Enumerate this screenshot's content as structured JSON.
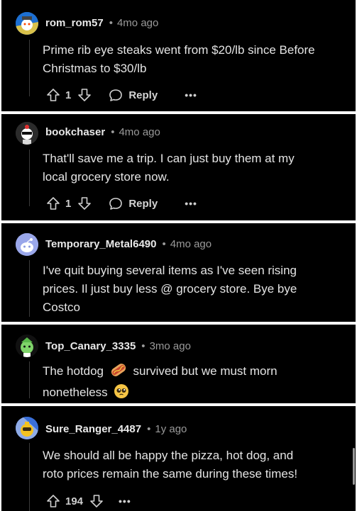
{
  "comments": [
    {
      "username": "rom_rom57",
      "separator": "•",
      "time": "4mo ago",
      "body_lines": [
        "Prime rib eye steaks went from $20/lb since Before",
        "Christmas to $30/lb"
      ],
      "score": "1",
      "reply_label": "Reply",
      "more_label": "•••"
    },
    {
      "username": "bookchaser",
      "separator": "•",
      "time": "4mo ago",
      "body_lines": [
        "That'll save me a trip. I can just buy them at my",
        "local grocery store now."
      ],
      "score": "1",
      "reply_label": "Reply",
      "more_label": "•••"
    },
    {
      "username": "Temporary_Metal6490",
      "separator": "•",
      "time": "4mo ago",
      "body_lines": [
        "I've quit buying several items as I've seen rising",
        "prices. Il just buy less @ grocery store. Bye bye",
        "Costco"
      ]
    },
    {
      "username": "Top_Canary_3335",
      "separator": "•",
      "time": "3mo ago",
      "body_lines": [
        "The hotdog",
        "survived but we must morn",
        "nonetheless"
      ]
    },
    {
      "username": "Sure_Ranger_4487",
      "separator": "•",
      "time": "1y ago",
      "body_lines": [
        "We should all be happy the pizza, hot dog, and",
        "roto prices remain the same during these times!"
      ],
      "score": "194",
      "more_label": "•••"
    }
  ],
  "colors": {
    "background": "#000000",
    "text": "#e4e4e4",
    "meta": "#9a9a9a",
    "separator_bar": "#ffffff"
  }
}
